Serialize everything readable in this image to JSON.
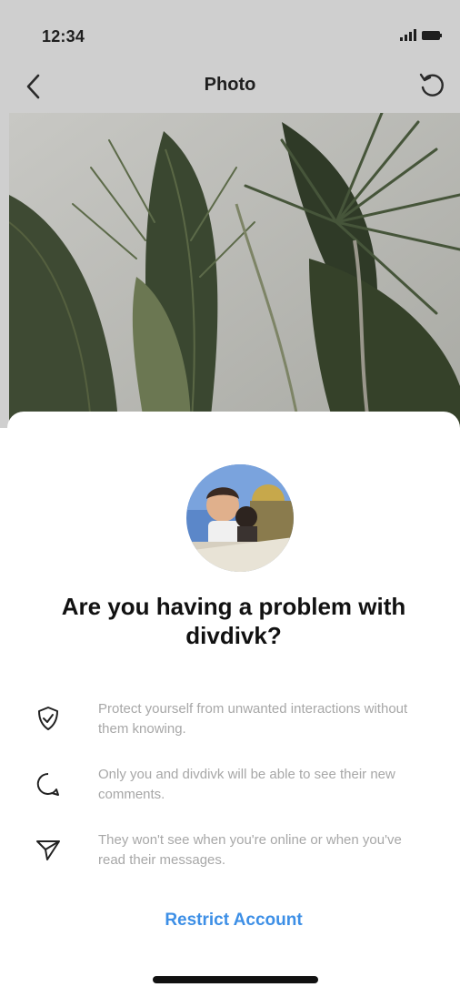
{
  "status_bar": {
    "time": "12:34"
  },
  "header": {
    "title": "Photo"
  },
  "sheet": {
    "title": "Are you having a problem with divdivk?",
    "features": [
      {
        "icon": "shield-check-icon",
        "text": "Protect yourself from unwanted interactions without them knowing."
      },
      {
        "icon": "comment-bubble-icon",
        "text": "Only you and divdivk will be able to see their new comments."
      },
      {
        "icon": "send-paper-plane-icon",
        "text": "They won't see when you're online or when you've read their messages."
      }
    ],
    "action_label": "Restrict Account"
  },
  "colors": {
    "accent": "#3d8fe6",
    "muted_text": "#a7a7a7",
    "title_text": "#111111"
  }
}
